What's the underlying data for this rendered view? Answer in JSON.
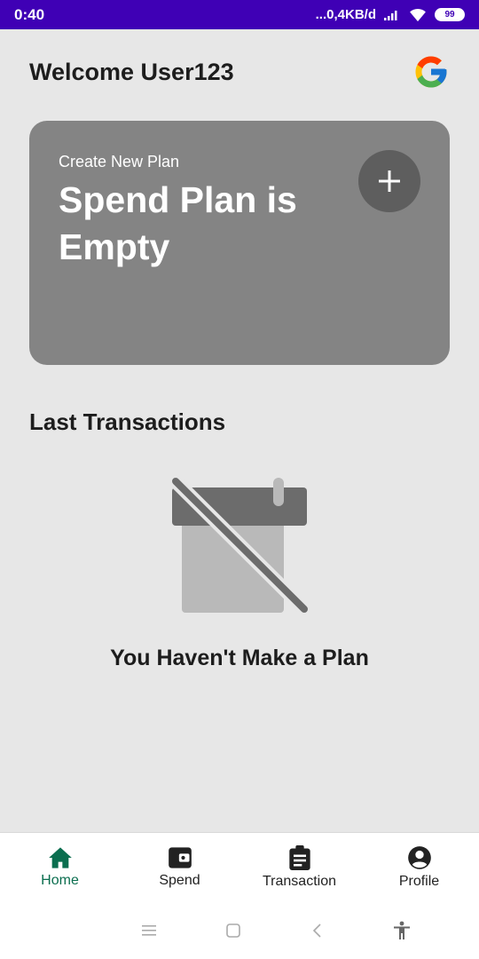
{
  "status": {
    "time": "0:40",
    "network": "...0,4KB/d",
    "battery": "99"
  },
  "header": {
    "welcome": "Welcome User123",
    "logo_icon": "google-logo-icon"
  },
  "plan_card": {
    "subtitle": "Create New Plan",
    "title": "Spend Plan is Empty",
    "add_icon": "plus-icon"
  },
  "transactions": {
    "title": "Last Transactions",
    "empty_message": "You Haven't Make a Plan",
    "empty_icon": "calendar-off-icon"
  },
  "bottom_nav": {
    "items": [
      {
        "label": "Home",
        "icon": "home-icon",
        "active": true
      },
      {
        "label": "Spend",
        "icon": "wallet-icon",
        "active": false
      },
      {
        "label": "Transaction",
        "icon": "clipboard-icon",
        "active": false
      },
      {
        "label": "Profile",
        "icon": "account-circle-icon",
        "active": false
      }
    ]
  },
  "colors": {
    "status_bar": "#3f00b5",
    "accent": "#0b6e4f",
    "card": "#848484",
    "background": "#e7e7e7"
  }
}
